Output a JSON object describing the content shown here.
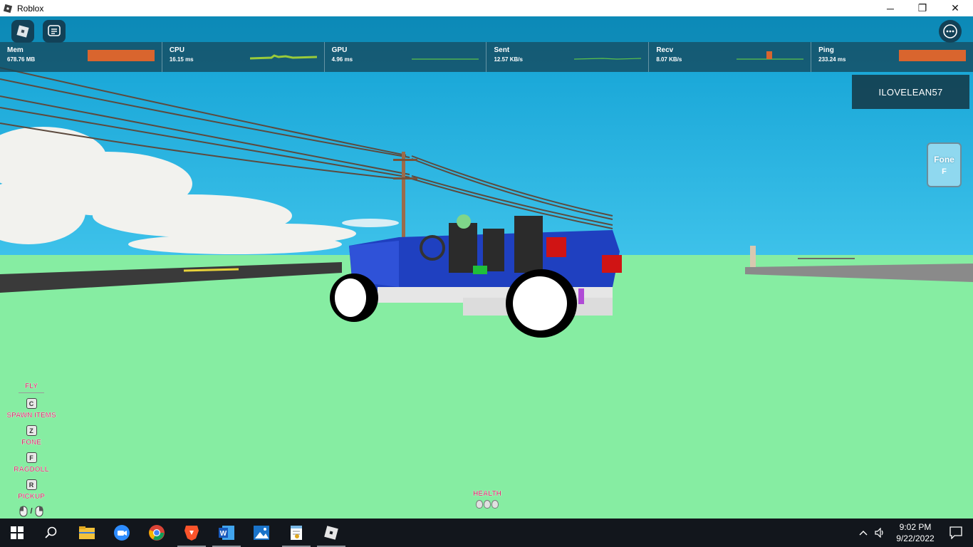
{
  "window": {
    "title": "Roblox",
    "icon": "roblox-logo-icon"
  },
  "window_controls": {
    "minimize": "─",
    "restore": "❐",
    "close": "✕"
  },
  "stats": [
    {
      "name": "Mem",
      "value": "678.76 MB"
    },
    {
      "name": "CPU",
      "value": "16.15 ms"
    },
    {
      "name": "GPU",
      "value": "4.96 ms"
    },
    {
      "name": "Sent",
      "value": "12.57 KB/s"
    },
    {
      "name": "Recv",
      "value": "8.07 KB/s"
    },
    {
      "name": "Ping",
      "value": "233.24 ms"
    }
  ],
  "player": {
    "username": "ILOVELEAN57"
  },
  "fone_button": {
    "label": "Fone",
    "key": "F"
  },
  "controls": [
    {
      "label": "Fly",
      "key": "C"
    },
    {
      "label": "Spawn Items",
      "key": "Z"
    },
    {
      "label": "Fone",
      "key": "F"
    },
    {
      "label": "Ragdoll",
      "key": "R"
    },
    {
      "label": "Pickup",
      "key": ""
    }
  ],
  "controls_mouse_sep": "/",
  "health": {
    "label": "Health",
    "hearts": 3
  },
  "taskbar": {
    "icons": [
      "windows-start-icon",
      "search-icon",
      "file-explorer-icon",
      "zoom-icon",
      "chrome-icon",
      "brave-icon",
      "word-icon",
      "photos-icon",
      "notepad-icon",
      "roblox-icon"
    ],
    "time": "9:02 PM",
    "date": "9/22/2022"
  },
  "colors": {
    "sky": "#1aa7d6",
    "grass": "#86eda2",
    "accent_orange": "#d9652e",
    "label_pink": "#d23a6e"
  }
}
